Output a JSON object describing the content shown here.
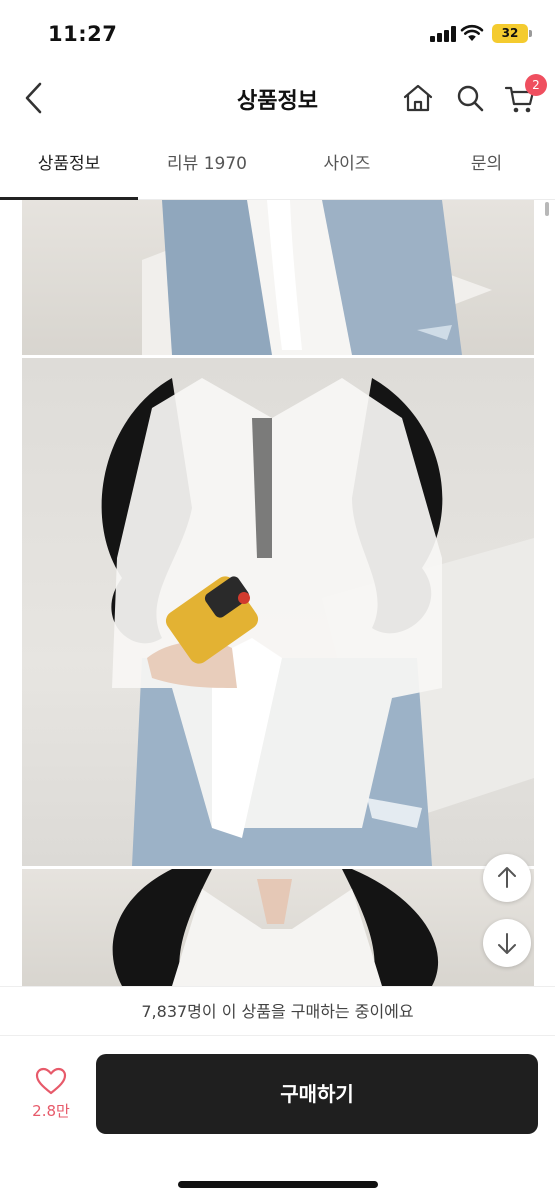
{
  "status_bar": {
    "time": "11:27",
    "battery": "32",
    "battery_color": "#f4cb2f"
  },
  "header": {
    "title": "상품정보",
    "icons": [
      "chevron-left-icon",
      "home-icon",
      "search-icon",
      "cart-icon"
    ],
    "cart_badge": "2",
    "badge_color": "#ef4f5f"
  },
  "tabs": [
    {
      "label": "상품정보",
      "active": true
    },
    {
      "label": "리뷰 1970",
      "active": false
    },
    {
      "label": "사이즈",
      "active": false
    },
    {
      "label": "문의",
      "active": false
    }
  ],
  "content": {
    "images": [
      "product-photo",
      "product-photo",
      "product-photo"
    ],
    "floating_buttons": [
      "arrow-up-icon",
      "arrow-down-icon"
    ]
  },
  "buyers_banner": {
    "text": "7,837명이 이 상품을 구매하는 중이에요"
  },
  "bottom_bar": {
    "like_count": "2.8만",
    "like_color": "#e75a6a",
    "buy_label": "구매하기",
    "buy_color": "#1f1f1f"
  }
}
